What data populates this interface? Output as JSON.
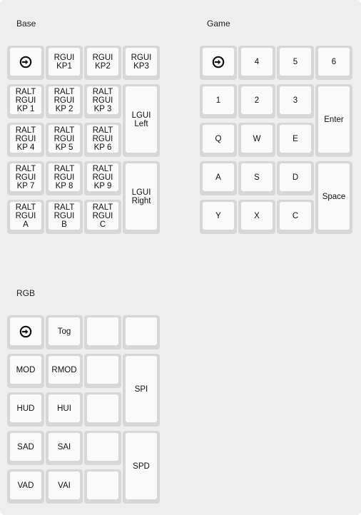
{
  "layers": [
    {
      "title": "Base",
      "keys": [
        {
          "label": "",
          "icon": "arrow-right-circle-icon"
        },
        {
          "label": "RGUI\nKP1"
        },
        {
          "label": "RGUI\nKP2"
        },
        {
          "label": "RGUI\nKP3"
        },
        {
          "label": "RALT\nRGUI\nKP 1"
        },
        {
          "label": "RALT\nRGUI\nKP 2"
        },
        {
          "label": "RALT\nRGUI\nKP 3"
        },
        {
          "label": "LGUI\nLeft"
        },
        {
          "label": "RALT\nRGUI\nKP 4"
        },
        {
          "label": "RALT\nRGUI\nKP 5"
        },
        {
          "label": "RALT\nRGUI\nKP 6"
        },
        {
          "label": "RALT\nRGUI\nKP 7"
        },
        {
          "label": "RALT\nRGUI\nKP 8"
        },
        {
          "label": "RALT\nRGUI\nKP 9"
        },
        {
          "label": "LGUI\nRight"
        },
        {
          "label": "RALT\nRGUI\nA"
        },
        {
          "label": "RALT\nRGUI\nB"
        },
        {
          "label": "RALT\nRGUI\nC"
        }
      ]
    },
    {
      "title": "Game",
      "keys": [
        {
          "label": "",
          "icon": "arrow-right-circle-icon"
        },
        {
          "label": "4"
        },
        {
          "label": "5"
        },
        {
          "label": "6"
        },
        {
          "label": "1"
        },
        {
          "label": "2"
        },
        {
          "label": "3"
        },
        {
          "label": "Enter"
        },
        {
          "label": "Q"
        },
        {
          "label": "W"
        },
        {
          "label": "E"
        },
        {
          "label": "A"
        },
        {
          "label": "S"
        },
        {
          "label": "D"
        },
        {
          "label": "Space"
        },
        {
          "label": "Y"
        },
        {
          "label": "X"
        },
        {
          "label": "C"
        }
      ]
    },
    {
      "title": "RGB",
      "keys": [
        {
          "label": "",
          "icon": "arrow-right-circle-icon"
        },
        {
          "label": "Tog"
        },
        {
          "label": ""
        },
        {
          "label": ""
        },
        {
          "label": "MOD"
        },
        {
          "label": "RMOD"
        },
        {
          "label": ""
        },
        {
          "label": "SPI"
        },
        {
          "label": "HUD"
        },
        {
          "label": "HUI"
        },
        {
          "label": ""
        },
        {
          "label": "SAD"
        },
        {
          "label": "SAI"
        },
        {
          "label": ""
        },
        {
          "label": "SPD"
        },
        {
          "label": "VAD"
        },
        {
          "label": "VAI"
        },
        {
          "label": ""
        }
      ]
    }
  ]
}
